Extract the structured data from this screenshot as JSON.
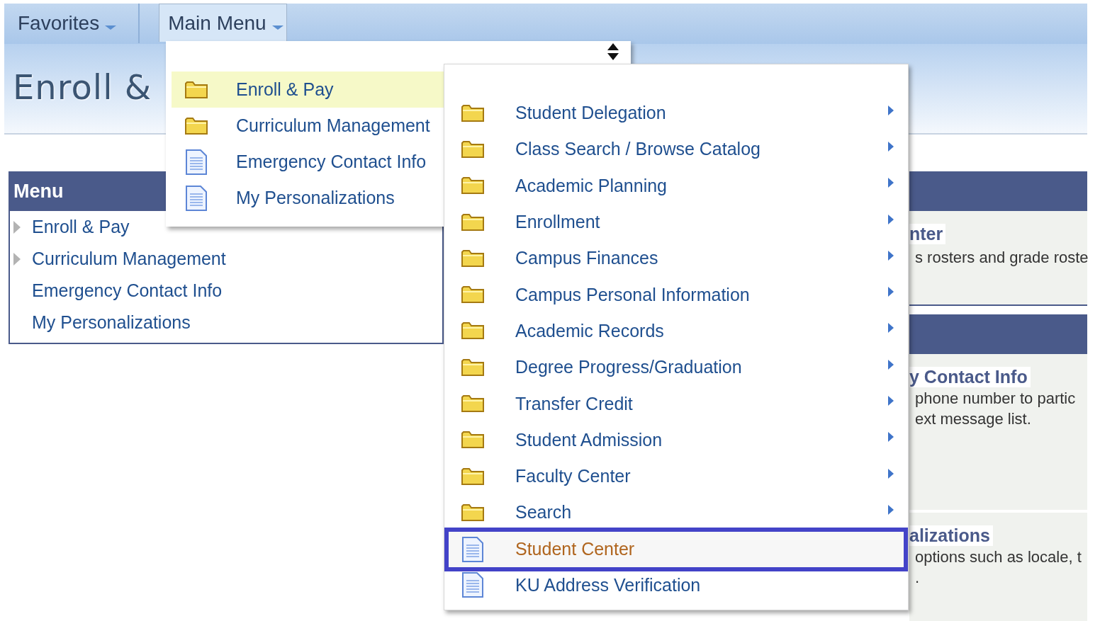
{
  "nav": {
    "items": [
      {
        "label": "Favorites",
        "selected": false
      },
      {
        "label": "Main Menu",
        "selected": true
      }
    ]
  },
  "banner": {
    "title": "Enroll &"
  },
  "menu_panel": {
    "title": "Menu",
    "items": [
      {
        "label": "Enroll & Pay",
        "kind": "folder"
      },
      {
        "label": "Curriculum Management",
        "kind": "folder"
      },
      {
        "label": "Emergency Contact Info",
        "kind": "page"
      },
      {
        "label": "My Personalizations",
        "kind": "page"
      }
    ]
  },
  "pagelets": [
    {
      "sections": [
        {
          "title": "nter",
          "lines": [
            "s rosters and grade roste"
          ]
        }
      ]
    },
    {
      "sections": [
        {
          "title": "y Contact Info",
          "lines": [
            "phone number to partic",
            "ext message list."
          ]
        },
        {
          "title": "alizations",
          "lines": [
            "options such as locale, t",
            "."
          ]
        }
      ]
    }
  ],
  "main_menu_dropdown": {
    "items": [
      {
        "label": "Enroll & Pay",
        "kind": "folder",
        "selected": true
      },
      {
        "label": "Curriculum Management",
        "kind": "folder",
        "selected": false
      },
      {
        "label": "Emergency Contact Info",
        "kind": "page",
        "selected": false
      },
      {
        "label": "My Personalizations",
        "kind": "page",
        "selected": false
      }
    ]
  },
  "submenu": {
    "items": [
      {
        "label": "Student Delegation",
        "kind": "folder",
        "selected": false
      },
      {
        "label": "Class Search / Browse Catalog",
        "kind": "folder",
        "selected": false
      },
      {
        "label": "Academic Planning",
        "kind": "folder",
        "selected": false
      },
      {
        "label": "Enrollment",
        "kind": "folder",
        "selected": false
      },
      {
        "label": "Campus Finances",
        "kind": "folder",
        "selected": false
      },
      {
        "label": "Campus Personal Information",
        "kind": "folder",
        "selected": false
      },
      {
        "label": "Academic Records",
        "kind": "folder",
        "selected": false
      },
      {
        "label": "Degree Progress/Graduation",
        "kind": "folder",
        "selected": false
      },
      {
        "label": "Transfer Credit",
        "kind": "folder",
        "selected": false
      },
      {
        "label": "Student Admission",
        "kind": "folder",
        "selected": false
      },
      {
        "label": "Faculty Center",
        "kind": "folder",
        "selected": false
      },
      {
        "label": "Search",
        "kind": "folder",
        "selected": false
      },
      {
        "label": "Student Center",
        "kind": "page",
        "selected": true
      },
      {
        "label": "KU Address Verification",
        "kind": "page",
        "selected": false
      }
    ]
  }
}
